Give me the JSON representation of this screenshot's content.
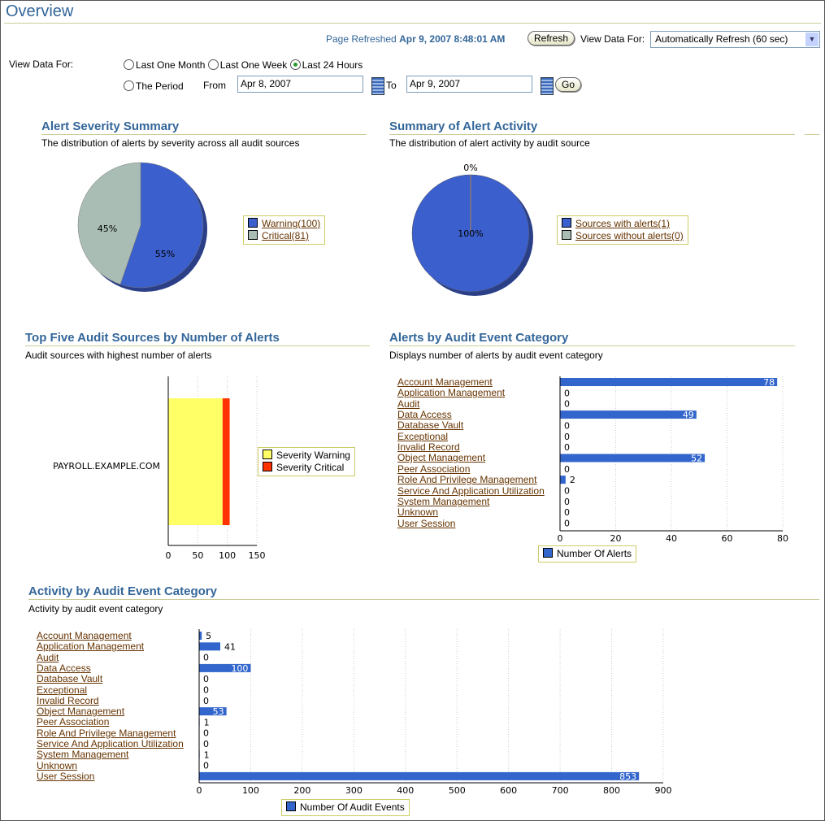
{
  "header": {
    "title": "Overview",
    "refreshed_label": "Page Refreshed",
    "refreshed_time": "Apr 9, 2007 8:48:01 AM",
    "refresh_button": "Refresh",
    "view_data_label": "View Data For:",
    "view_data_select": "Automatically Refresh (60 sec)"
  },
  "filter": {
    "label": "View Data For:",
    "options": [
      {
        "label": "Last One Month",
        "selected": false
      },
      {
        "label": "Last One Week",
        "selected": false
      },
      {
        "label": "Last 24 Hours",
        "selected": true
      }
    ],
    "period_label": "The Period",
    "from_label": "From",
    "from_value": "Apr 8, 2007",
    "to_label": "To",
    "to_value": "Apr 9, 2007",
    "go_button": "Go"
  },
  "colors": {
    "accent": "#336699",
    "bar": "#3366cc",
    "warning": "#ffff66",
    "critical": "#ff3300",
    "pie_grey": "#a9bdb5",
    "link": "#663300"
  },
  "sections": {
    "severity": {
      "title": "Alert Severity Summary",
      "subtitle": "The distribution of alerts by severity across all audit sources"
    },
    "activity_summary": {
      "title": "Summary of Alert Activity",
      "subtitle": "The distribution of alert activity by audit source"
    },
    "top_five": {
      "title": "Top Five Audit Sources by Number of Alerts",
      "subtitle": "Audit sources with highest number of alerts"
    },
    "alerts_by_cat": {
      "title": "Alerts by Audit Event Category",
      "subtitle": "Displays number of alerts by audit event category"
    },
    "activity_by_cat": {
      "title": "Activity by Audit Event Category",
      "subtitle": "Activity by audit event category"
    }
  },
  "chart_data": [
    {
      "type": "pie",
      "slices": [
        {
          "label": "Warning(100)",
          "value": 100,
          "percent_label": "55%",
          "color": "#3b5fcc"
        },
        {
          "label": "Critical(81)",
          "value": 81,
          "percent_label": "45%",
          "color": "#a9bdb5"
        }
      ]
    },
    {
      "type": "pie",
      "slices": [
        {
          "label": "Sources with alerts(1)",
          "value": 1,
          "percent_label": "100%",
          "color": "#3b5fcc"
        },
        {
          "label": "Sources without alerts(0)",
          "value": 0,
          "percent_label": "0%",
          "color": "#a9bdb5"
        }
      ]
    },
    {
      "type": "bar",
      "orientation": "horizontal",
      "stacked": true,
      "categories": [
        "PAYROLL.EXAMPLE.COM"
      ],
      "series": [
        {
          "name": "Severity Warning",
          "values": [
            92
          ],
          "color": "#ffff66"
        },
        {
          "name": "Severity Critical",
          "values": [
            12
          ],
          "color": "#ff3300"
        }
      ],
      "xlim": [
        0,
        150
      ],
      "xticks": [
        "0",
        "50",
        "100",
        "150"
      ],
      "grid": true
    },
    {
      "type": "bar",
      "orientation": "horizontal",
      "categories": [
        "Account Management",
        "Application Management",
        "Audit",
        "Data Access",
        "Database Vault",
        "Exceptional",
        "Invalid Record",
        "Object Management",
        "Peer Association",
        "Role And Privilege Management",
        "Service And Application Utilization",
        "System Management",
        "Unknown",
        "User Session"
      ],
      "series": [
        {
          "name": "Number Of Alerts",
          "values": [
            78,
            0,
            0,
            49,
            0,
            0,
            0,
            52,
            0,
            2,
            0,
            0,
            0,
            0
          ]
        }
      ],
      "xlim": [
        0,
        80
      ],
      "xticks": [
        "0",
        "20",
        "40",
        "60",
        "80"
      ],
      "grid": true
    },
    {
      "type": "bar",
      "orientation": "horizontal",
      "categories": [
        "Account Management",
        "Application Management",
        "Audit",
        "Data Access",
        "Database Vault",
        "Exceptional",
        "Invalid Record",
        "Object Management",
        "Peer Association",
        "Role And Privilege Management",
        "Service And Application Utilization",
        "System Management",
        "Unknown",
        "User Session"
      ],
      "series": [
        {
          "name": "Number Of Audit Events",
          "values": [
            5,
            41,
            0,
            100,
            0,
            0,
            0,
            53,
            1,
            0,
            0,
            1,
            0,
            853
          ]
        }
      ],
      "xlim": [
        0,
        900
      ],
      "xticks": [
        "0",
        "100",
        "200",
        "300",
        "400",
        "500",
        "600",
        "700",
        "800",
        "900"
      ],
      "grid": true
    }
  ]
}
